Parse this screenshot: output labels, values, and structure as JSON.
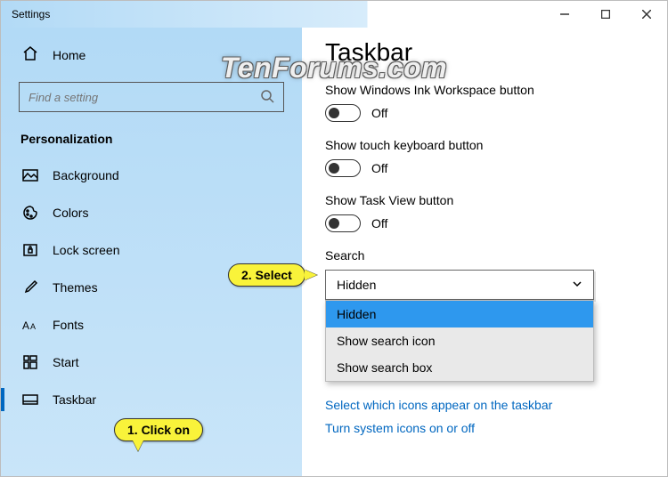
{
  "window": {
    "title": "Settings"
  },
  "sidebar": {
    "home": "Home",
    "search_placeholder": "Find a setting",
    "section": "Personalization",
    "items": [
      {
        "label": "Background"
      },
      {
        "label": "Colors"
      },
      {
        "label": "Lock screen"
      },
      {
        "label": "Themes"
      },
      {
        "label": "Fonts"
      },
      {
        "label": "Start"
      },
      {
        "label": "Taskbar"
      }
    ]
  },
  "main": {
    "title": "Taskbar",
    "settings": [
      {
        "label": "Show Windows Ink Workspace button",
        "state": "Off"
      },
      {
        "label": "Show touch keyboard button",
        "state": "Off"
      },
      {
        "label": "Show Task View button",
        "state": "Off"
      }
    ],
    "search_label": "Search",
    "dropdown_value": "Hidden",
    "options": [
      "Hidden",
      "Show search icon",
      "Show search box"
    ],
    "links": [
      "Select which icons appear on the taskbar",
      "Turn system icons on or off"
    ]
  },
  "callouts": {
    "c1": "1. Click on",
    "c2": "2. Select"
  },
  "watermark": "TenForums.com"
}
